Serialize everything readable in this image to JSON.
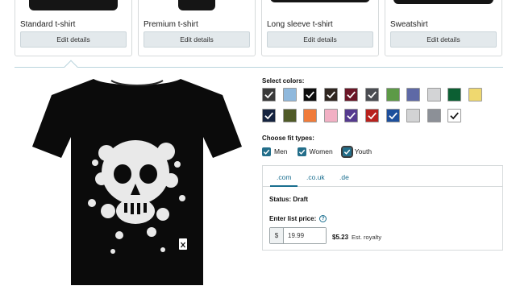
{
  "product_cards": [
    {
      "name": "Standard t-shirt",
      "button": "Edit details"
    },
    {
      "name": "Premium t-shirt",
      "button": "Edit details"
    },
    {
      "name": "Long sleeve t-shirt",
      "button": "Edit details"
    },
    {
      "name": "Sweatshirt",
      "button": "Edit details"
    }
  ],
  "colors": {
    "title": "Select colors:",
    "swatches": [
      {
        "name": "dark-grey",
        "color": "#3a3a3a",
        "selected": true,
        "check": "#ffffff"
      },
      {
        "name": "light-blue",
        "color": "#8fb8dc",
        "selected": false
      },
      {
        "name": "black",
        "color": "#0d0d0d",
        "selected": true,
        "check": "#ffffff"
      },
      {
        "name": "brown",
        "color": "#2f2620",
        "selected": true,
        "check": "#ffffff"
      },
      {
        "name": "cranberry",
        "color": "#6a1627",
        "selected": true,
        "check": "#ffffff"
      },
      {
        "name": "charcoal",
        "color": "#4b4d52",
        "selected": true,
        "check": "#ffffff"
      },
      {
        "name": "grass",
        "color": "#5d9a47",
        "selected": false
      },
      {
        "name": "heather-blue",
        "color": "#5e69a6",
        "selected": false
      },
      {
        "name": "heather-grey",
        "color": "#d3d4d6",
        "selected": false
      },
      {
        "name": "kelly-green",
        "color": "#0c5f33",
        "selected": false
      },
      {
        "name": "lemon",
        "color": "#efd86f",
        "selected": false
      },
      {
        "name": "navy",
        "color": "#15233f",
        "selected": true,
        "check": "#ffffff"
      },
      {
        "name": "olive",
        "color": "#4f5a27",
        "selected": false
      },
      {
        "name": "orange",
        "color": "#f07b3a",
        "selected": false
      },
      {
        "name": "pink",
        "color": "#f2b0c4",
        "selected": false
      },
      {
        "name": "purple",
        "color": "#553a8e",
        "selected": true,
        "check": "#ffffff"
      },
      {
        "name": "red",
        "color": "#b8211d",
        "selected": true,
        "check": "#ffffff"
      },
      {
        "name": "royal-blue",
        "color": "#1d4f9c",
        "selected": true,
        "check": "#ffffff"
      },
      {
        "name": "silver",
        "color": "#d2d3d4",
        "selected": false
      },
      {
        "name": "slate",
        "color": "#8c9097",
        "selected": false
      },
      {
        "name": "white",
        "color": "#ffffff",
        "selected": true,
        "check": "#111111"
      }
    ]
  },
  "fit": {
    "title": "Choose fit types:",
    "options": [
      {
        "label": "Men",
        "checked": true
      },
      {
        "label": "Women",
        "checked": true
      },
      {
        "label": "Youth",
        "checked": true
      }
    ]
  },
  "marketplace": {
    "tabs": [
      ".com",
      ".co.uk",
      ".de"
    ],
    "status": "Status: Draft",
    "price_label": "Enter list price:",
    "currency": "$",
    "price_value": "19.99",
    "royalty_value": "$5.23",
    "royalty_label": "Est. royalty"
  },
  "accent_color": "#236e8a"
}
